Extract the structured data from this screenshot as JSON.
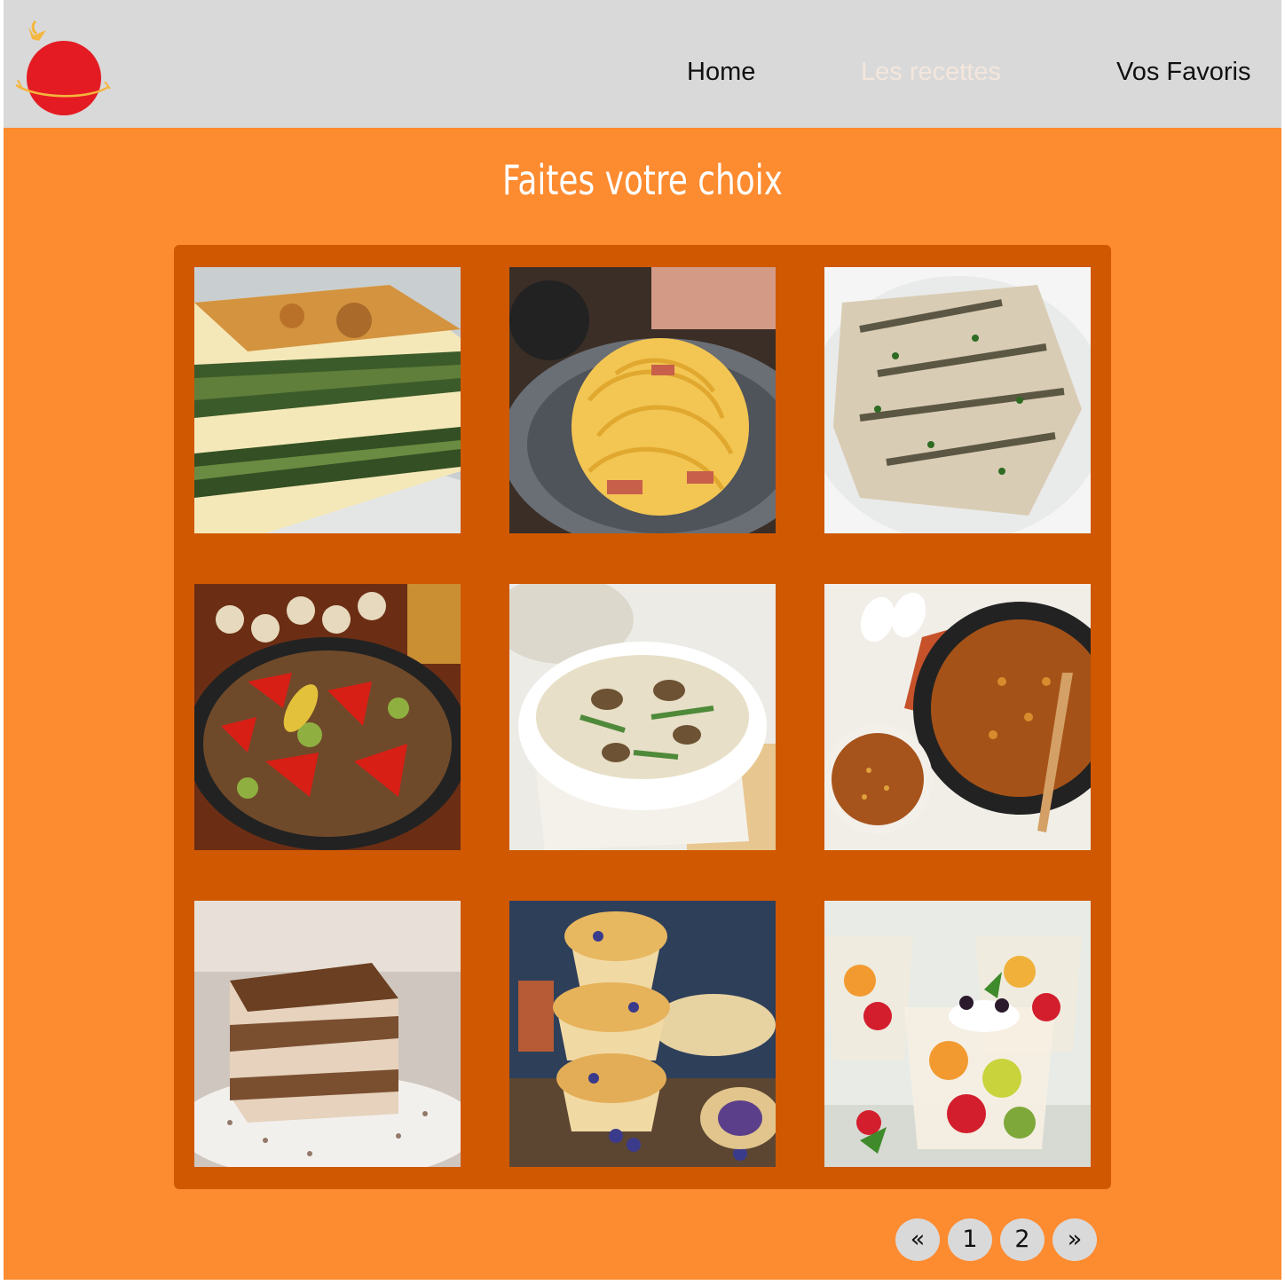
{
  "nav": {
    "home": "Home",
    "recettes": "Les recettes",
    "favoris": "Vos Favoris",
    "active_color": "#f4e6dd"
  },
  "colors": {
    "header": "#d9d9d9",
    "background": "#fd8b30",
    "grid_panel": "#d05800",
    "logo": "#e41b23",
    "pager": "#d9d9d9"
  },
  "page_title": "Faites votre choix",
  "recipes": [
    {
      "image": "spinach-lasagna-photo"
    },
    {
      "image": "carbonara-pasta-photo"
    },
    {
      "image": "herb-roast-chicken-photo"
    },
    {
      "image": "ratatouille-pan-photo"
    },
    {
      "image": "mushroom-asparagus-risotto-photo"
    },
    {
      "image": "lentil-soup-pot-photo"
    },
    {
      "image": "tiramisu-slice-photo"
    },
    {
      "image": "blueberry-muffins-photo"
    },
    {
      "image": "fruit-salad-cups-photo"
    }
  ],
  "pagination": {
    "prev": "«",
    "pages": [
      "1",
      "2"
    ],
    "next": "»"
  }
}
